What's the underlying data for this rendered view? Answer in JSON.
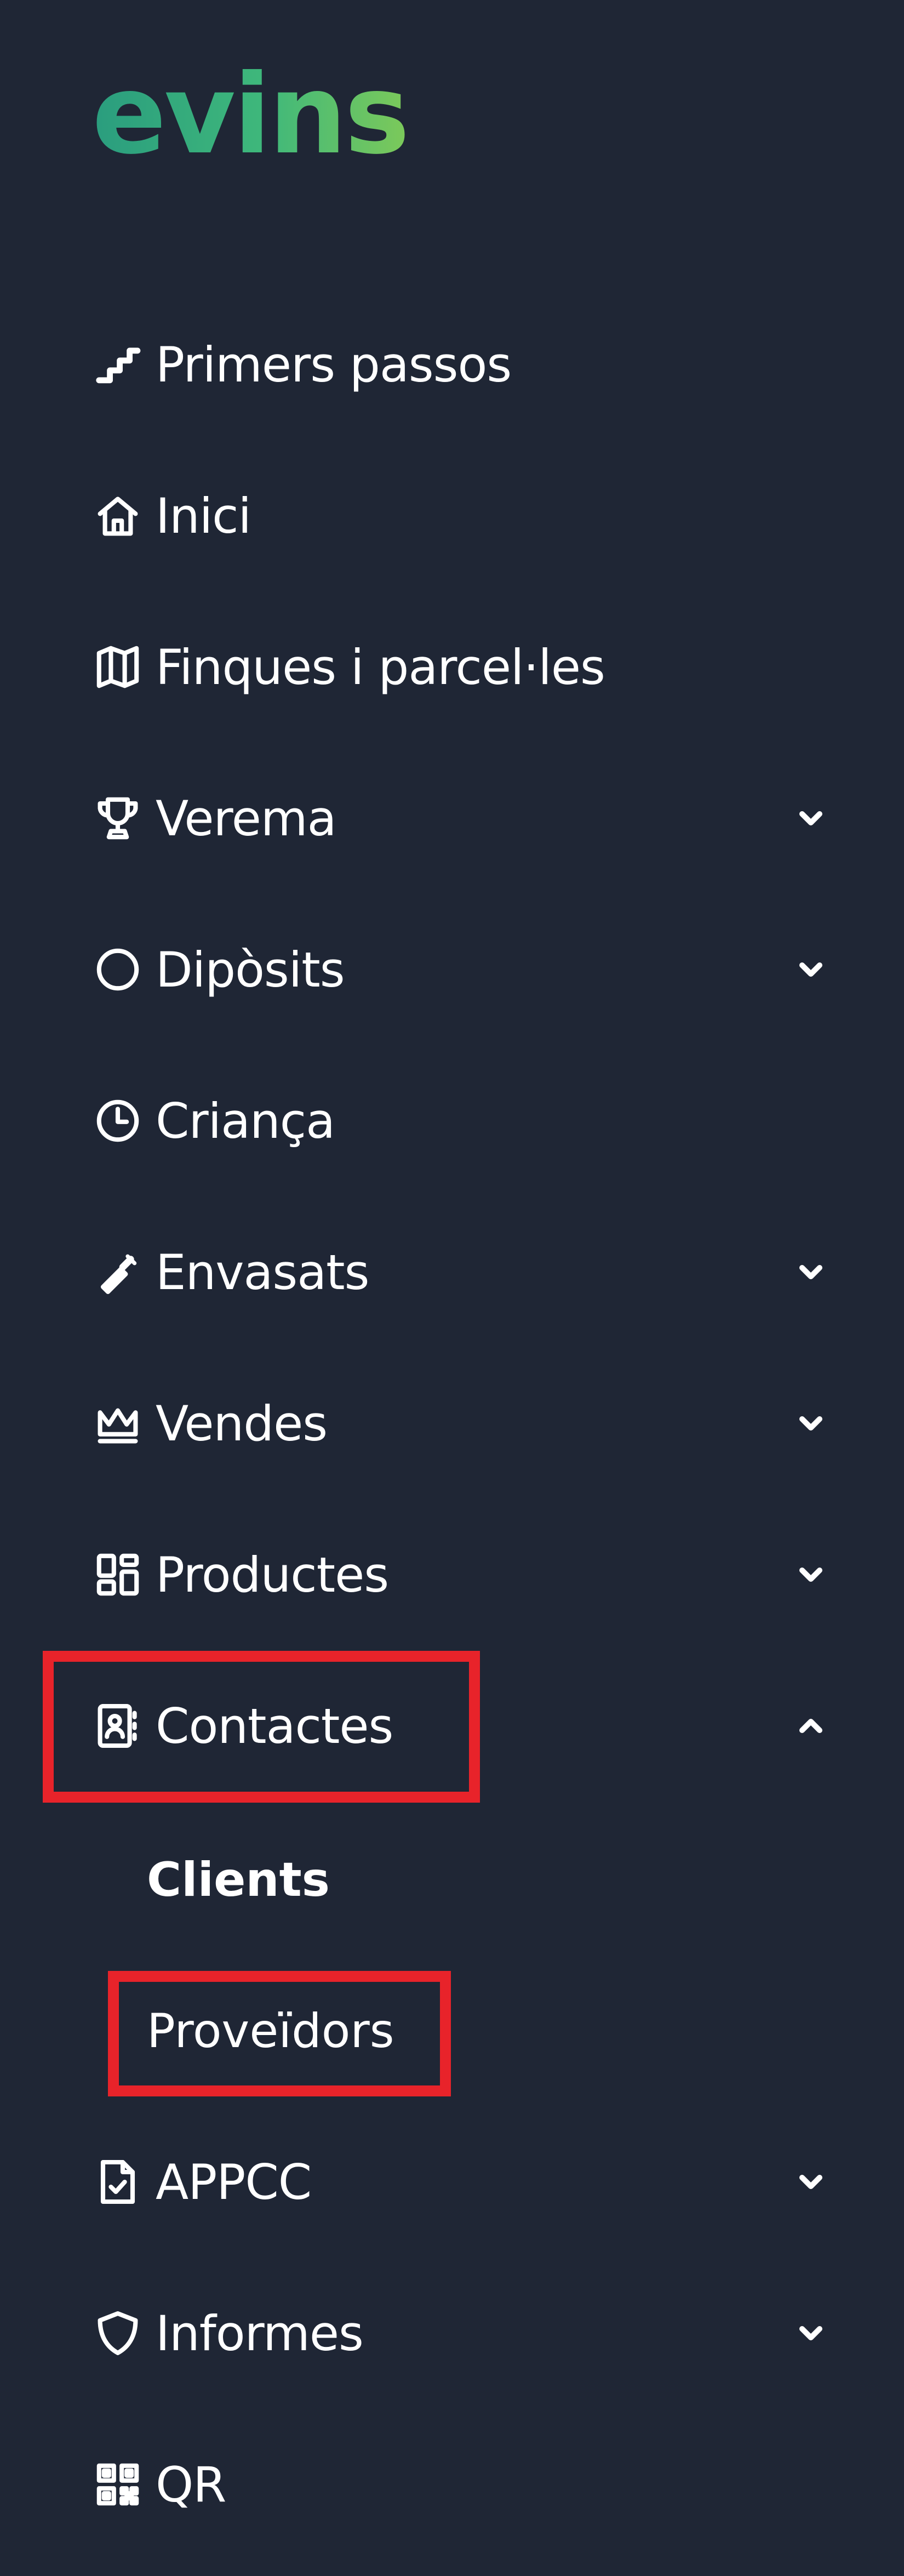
{
  "brand": {
    "logo_text": "evins"
  },
  "sidebar": {
    "items": [
      {
        "label": "Primers passos",
        "icon": "stairs-icon"
      },
      {
        "label": "Inici",
        "icon": "home-icon"
      },
      {
        "label": "Finques i parcel·les",
        "icon": "map-icon"
      },
      {
        "label": "Verema",
        "icon": "trophy-icon",
        "expandable": true
      },
      {
        "label": "Dipòsits",
        "icon": "circle-icon",
        "expandable": true
      },
      {
        "label": "Criança",
        "icon": "clock-icon"
      },
      {
        "label": "Envasats",
        "icon": "bottle-icon",
        "expandable": true
      },
      {
        "label": "Vendes",
        "icon": "crown-icon",
        "expandable": true
      },
      {
        "label": "Productes",
        "icon": "grid-icon",
        "expandable": true
      },
      {
        "label": "Contactes",
        "icon": "contact-book-icon",
        "expandable": true,
        "expanded": true,
        "children": [
          {
            "label": "Clients",
            "active": true
          },
          {
            "label": "Proveïdors"
          }
        ]
      },
      {
        "label": "APPCC",
        "icon": "file-check-icon",
        "expandable": true
      },
      {
        "label": "Informes",
        "icon": "shield-icon",
        "expandable": true
      },
      {
        "label": "QR",
        "icon": "qr-icon"
      }
    ]
  },
  "colors": {
    "background": "#1f2635",
    "text": "#ffffff",
    "highlight": "#e8232a",
    "logo_start": "#2a9d7e",
    "logo_end": "#7cc95a"
  }
}
